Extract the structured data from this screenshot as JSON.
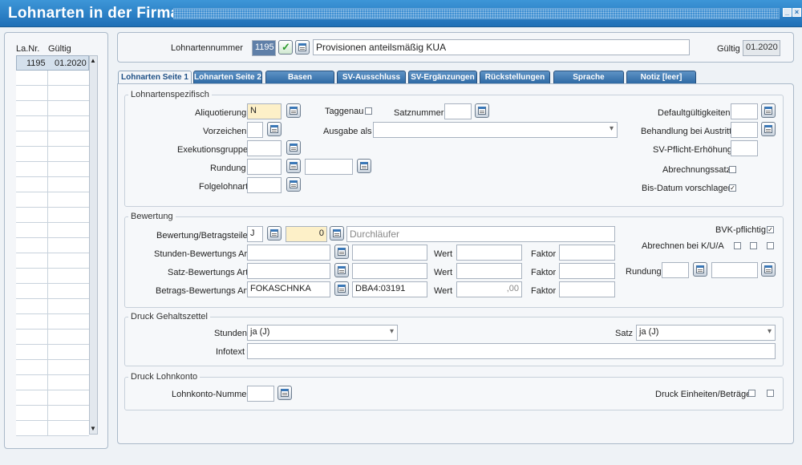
{
  "window": {
    "title": "Lohnarten in der Firma"
  },
  "left_list": {
    "col_nr": "La.Nr.",
    "col_gueltig": "Gültig",
    "rows": [
      {
        "nr": "1195",
        "gueltig": "01.2020"
      }
    ]
  },
  "header": {
    "nummer_label": "Lohnartennummer",
    "nummer_value": "1195",
    "bezeichnung": "Provisionen anteilsmäßig KUA",
    "gueltig_label": "Gültig",
    "gueltig_value": "01.2020"
  },
  "tabs": [
    "Lohnarten Seite 1",
    "Lohnarten Seite 2",
    "Basen",
    "SV-Ausschluss",
    "SV-Ergänzungen",
    "Rückstellungen",
    "Sprache",
    "Notiz [leer]"
  ],
  "lohnartenspezifisch": {
    "title": "Lohnartenspezifisch",
    "aliquotierung_label": "Aliquotierung",
    "aliquotierung_value": "N",
    "vorzeichen_label": "Vorzeichen",
    "exekution_label": "Exekutionsgruppe",
    "rundung_label": "Rundung",
    "folgelohnart_label": "Folgelohnart",
    "taggenau_label": "Taggenau",
    "satznummer_label": "Satznummer",
    "ausgabe_label": "Ausgabe als",
    "default_label": "Defaultgültigkeiten",
    "behandlung_label": "Behandlung bei Austritt",
    "svpflicht_label": "SV-Pflicht-Erhöhung",
    "abrechnungssatz_label": "Abrechnungssatz",
    "bisdatum_label": "Bis-Datum vorschlagen"
  },
  "bewertung": {
    "title": "Bewertung",
    "betragsteiler_label": "Bewertung/Betragsteiler",
    "betragsteiler_value": "J",
    "betragsteiler_num": "0",
    "durchlaeufer": "Durchläufer",
    "stunden_label": "Stunden-Bewertungs Art",
    "satz_label": "Satz-Bewertungs Art",
    "betrags_label": "Betrags-Bewertungs Art",
    "betrags_value": "FOKASCHNKA",
    "betrags_code": "DBA4:03191",
    "wert_label": "Wert",
    "wert_betrags": ",00",
    "faktor_label": "Faktor",
    "bvk_label": "BVK-pflichtig",
    "abrechnen_label": "Abrechnen bei K/U/A",
    "rundung_label": "Rundung"
  },
  "druck_gehalt": {
    "title": "Druck Gehaltszettel",
    "stunden_label": "Stunden",
    "stunden_value": "ja (J)",
    "satz_label": "Satz",
    "satz_value": "ja (J)",
    "infotext_label": "Infotext"
  },
  "druck_lohnkonto": {
    "title": "Druck Lohnkonto",
    "nummer_label": "Lohnkonto-Nummer",
    "einheiten_label": "Druck Einheiten/Beträge"
  }
}
